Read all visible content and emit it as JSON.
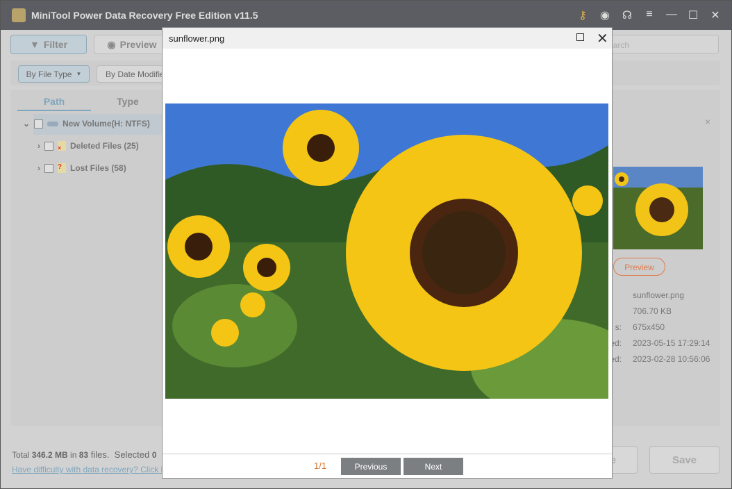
{
  "window": {
    "title": "MiniTool Power Data Recovery Free Edition v11.5",
    "icons": [
      "key-icon",
      "disc-icon",
      "headset-icon",
      "menu-icon",
      "minimize-icon",
      "maximize-icon",
      "close-icon"
    ]
  },
  "toolbar": {
    "filter": "Filter",
    "preview": "Preview",
    "search_placeholder": "earch"
  },
  "filters": {
    "by_file_type": "By File Type",
    "by_date_modified": "By Date Modifie"
  },
  "tabs": {
    "path": "Path",
    "type": "Type"
  },
  "tree": [
    {
      "label": "New Volume(H: NTFS)"
    },
    {
      "label": "Deleted Files (25)"
    },
    {
      "label": "Lost Files (58)"
    }
  ],
  "details": {
    "preview_button": "Preview",
    "rows": [
      {
        "label": "",
        "value": "sunflower.png"
      },
      {
        "label": "",
        "value": "706.70 KB"
      },
      {
        "label": "s:",
        "value": "675x450"
      },
      {
        "label": "ed:",
        "value": "2023-05-15 17:29:14"
      },
      {
        "label": "ed:",
        "value": "2023-02-28 10:56:06"
      }
    ]
  },
  "status": {
    "total_prefix": "Total ",
    "total_size": "346.2 MB",
    "in": " in ",
    "count": "83",
    "files": " files.  Selected ",
    "selected": "0",
    "help_link": "Have difficulty with data recovery? Click h"
  },
  "bottom": {
    "partial_button": "e",
    "save": "Save"
  },
  "modal": {
    "title": "sunflower.png",
    "page": "1/1",
    "previous": "Previous",
    "next": "Next"
  }
}
